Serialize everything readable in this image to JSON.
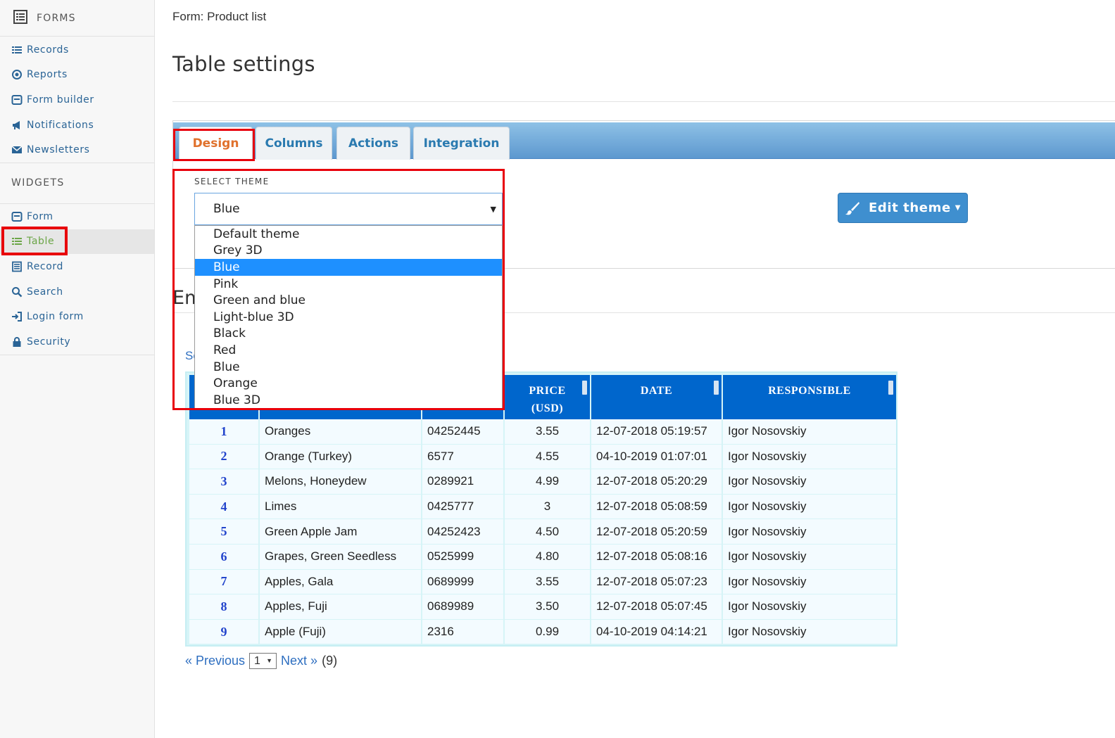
{
  "sidebar": {
    "header": "FORMS",
    "forms_items": [
      {
        "label": "Records",
        "icon": "list-icon"
      },
      {
        "label": "Reports",
        "icon": "target-icon"
      },
      {
        "label": "Form builder",
        "icon": "form-icon"
      },
      {
        "label": "Notifications",
        "icon": "megaphone-icon"
      },
      {
        "label": "Newsletters",
        "icon": "envelope-icon"
      }
    ],
    "widgets_header": "WIDGETS",
    "widgets_items": [
      {
        "label": "Form",
        "icon": "form-icon"
      },
      {
        "label": "Table",
        "icon": "list-icon",
        "active": true
      },
      {
        "label": "Record",
        "icon": "record-icon"
      },
      {
        "label": "Search",
        "icon": "search-icon"
      },
      {
        "label": "Login form",
        "icon": "login-icon"
      },
      {
        "label": "Security",
        "icon": "lock-icon"
      }
    ]
  },
  "breadcrumb": "Form: Product list",
  "page_title": "Table settings",
  "tabs": [
    {
      "label": "Design",
      "active": true
    },
    {
      "label": "Columns"
    },
    {
      "label": "Actions"
    },
    {
      "label": "Integration"
    }
  ],
  "theme": {
    "label": "SELECT THEME",
    "selected": "Blue",
    "options": [
      "Default theme",
      "Grey 3D",
      "Blue",
      "Pink",
      "Green and blue",
      "Light-blue 3D",
      "Black",
      "Red",
      "Blue",
      "Orange",
      "Blue 3D"
    ],
    "selected_index": 2
  },
  "edit_theme_button": "Edit theme",
  "partial_text": {
    "heading": "Em",
    "link": "Se"
  },
  "table": {
    "headers": {
      "price_line1": "PRICE",
      "price_line2": "(USD)",
      "date": "DATE",
      "responsible": "RESPONSIBLE"
    },
    "rows": [
      {
        "n": "1",
        "name": "Oranges",
        "code": "04252445",
        "price": "3.55",
        "date": "12-07-2018 05:19:57",
        "responsible": "Igor Nosovskiy"
      },
      {
        "n": "2",
        "name": "Orange (Turkey)",
        "code": "6577",
        "price": "4.55",
        "date": "04-10-2019 01:07:01",
        "responsible": "Igor Nosovskiy"
      },
      {
        "n": "3",
        "name": "Melons, Honeydew",
        "code": "0289921",
        "price": "4.99",
        "date": "12-07-2018 05:20:29",
        "responsible": "Igor Nosovskiy"
      },
      {
        "n": "4",
        "name": "Limes",
        "code": "0425777",
        "price": "3",
        "date": "12-07-2018 05:08:59",
        "responsible": "Igor Nosovskiy"
      },
      {
        "n": "5",
        "name": "Green Apple Jam",
        "code": "04252423",
        "price": "4.50",
        "date": "12-07-2018 05:20:59",
        "responsible": "Igor Nosovskiy"
      },
      {
        "n": "6",
        "name": "Grapes, Green Seedless",
        "code": "0525999",
        "price": "4.80",
        "date": "12-07-2018 05:08:16",
        "responsible": "Igor Nosovskiy"
      },
      {
        "n": "7",
        "name": "Apples, Gala",
        "code": "0689999",
        "price": "3.55",
        "date": "12-07-2018 05:07:23",
        "responsible": "Igor Nosovskiy"
      },
      {
        "n": "8",
        "name": "Apples, Fuji",
        "code": "0689989",
        "price": "3.50",
        "date": "12-07-2018 05:07:45",
        "responsible": "Igor Nosovskiy"
      },
      {
        "n": "9",
        "name": "Apple (Fuji)",
        "code": "2316",
        "price": "0.99",
        "date": "04-10-2019 04:14:21",
        "responsible": "Igor Nosovskiy"
      }
    ]
  },
  "pager": {
    "previous": "« Previous",
    "page": "1",
    "next": "Next »",
    "count": "(9)"
  },
  "colors": {
    "accent": "#0066cc",
    "highlight": "#e8000b",
    "active_tab": "#e0712c",
    "link": "#2a6496"
  }
}
